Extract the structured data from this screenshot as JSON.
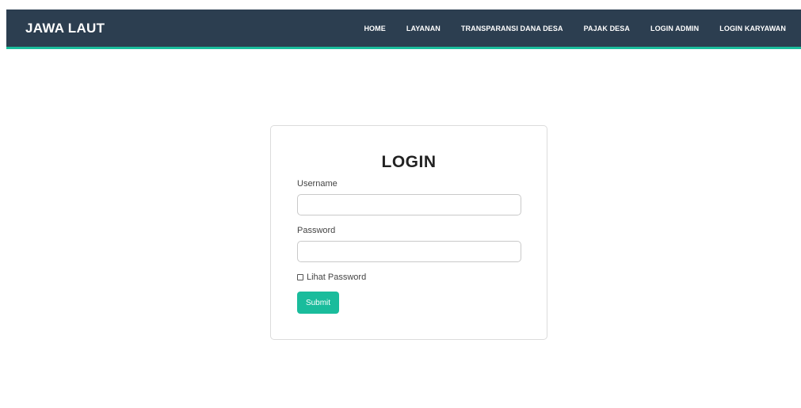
{
  "navbar": {
    "brand": "JAWA LAUT",
    "links": [
      {
        "label": "HOME"
      },
      {
        "label": "LAYANAN"
      },
      {
        "label": "TRANSPARANSI DANA DESA"
      },
      {
        "label": "PAJAK DESA"
      },
      {
        "label": "LOGIN ADMIN"
      },
      {
        "label": "LOGIN KARYAWAN"
      }
    ],
    "background_color": "#2c3e50",
    "accent_color": "#1abc9c"
  },
  "login_form": {
    "title": "LOGIN",
    "username_label": "Username",
    "username_value": "",
    "password_label": "Password",
    "password_value": "",
    "show_password_label": "Lihat Password",
    "show_password_checked": false,
    "submit_label": "Submit",
    "submit_color": "#1abc9c"
  }
}
